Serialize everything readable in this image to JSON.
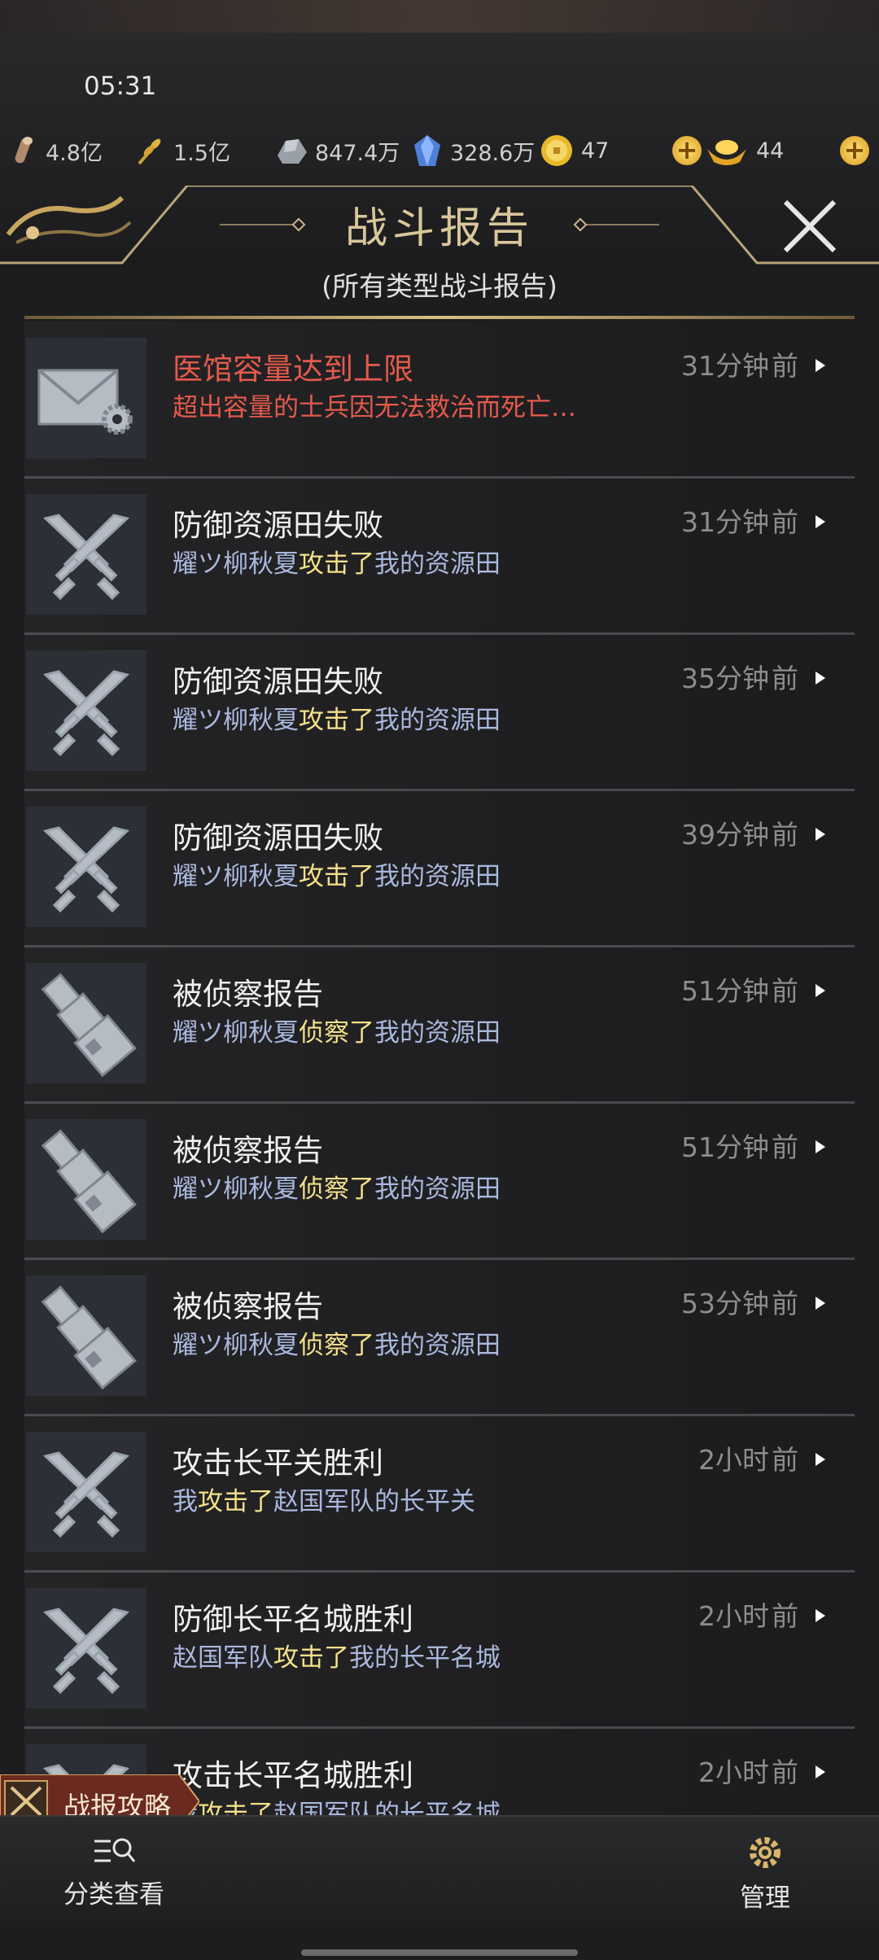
{
  "status_bar": {
    "time": "05:31"
  },
  "resources": [
    {
      "icon": "wood-log-icon",
      "value": "4.8亿"
    },
    {
      "icon": "wheat-icon",
      "value": "1.5亿"
    },
    {
      "icon": "stone-icon",
      "value": "847.4万"
    },
    {
      "icon": "crystal-icon",
      "value": "328.6万"
    },
    {
      "icon": "coin-icon",
      "value": "47"
    },
    {
      "icon": "gold-ingot-icon",
      "value": "44"
    }
  ],
  "header": {
    "title": "战斗报告",
    "subtitle": "(所有类型战斗报告)"
  },
  "reports": [
    {
      "icon": "mail-gear-icon",
      "title": "医馆容量达到上限",
      "title_color": "red",
      "desc_parts": [
        {
          "t": "超出容量的士兵因无法救治而死亡…",
          "c": "red"
        }
      ],
      "time": "31分钟",
      "ago": "前"
    },
    {
      "icon": "crossed-swords-icon",
      "title": "防御资源田失败",
      "desc_parts": [
        {
          "t": "耀ツ柳秋夏",
          "c": "n"
        },
        {
          "t": "攻击了",
          "c": "hl"
        },
        {
          "t": "我的资源田",
          "c": "n"
        }
      ],
      "time": "31分钟",
      "ago": "前"
    },
    {
      "icon": "crossed-swords-icon",
      "title": "防御资源田失败",
      "desc_parts": [
        {
          "t": "耀ツ柳秋夏",
          "c": "n"
        },
        {
          "t": "攻击了",
          "c": "hl"
        },
        {
          "t": "我的资源田",
          "c": "n"
        }
      ],
      "time": "35分钟",
      "ago": "前"
    },
    {
      "icon": "crossed-swords-icon",
      "title": "防御资源田失败",
      "desc_parts": [
        {
          "t": "耀ツ柳秋夏",
          "c": "n"
        },
        {
          "t": "攻击了",
          "c": "hl"
        },
        {
          "t": "我的资源田",
          "c": "n"
        }
      ],
      "time": "39分钟",
      "ago": "前"
    },
    {
      "icon": "spyglass-icon",
      "title": "被侦察报告",
      "desc_parts": [
        {
          "t": "耀ツ柳秋夏",
          "c": "n"
        },
        {
          "t": "侦察了",
          "c": "hl"
        },
        {
          "t": "我的资源田",
          "c": "n"
        }
      ],
      "time": "51分钟",
      "ago": "前"
    },
    {
      "icon": "spyglass-icon",
      "title": "被侦察报告",
      "desc_parts": [
        {
          "t": "耀ツ柳秋夏",
          "c": "n"
        },
        {
          "t": "侦察了",
          "c": "hl"
        },
        {
          "t": "我的资源田",
          "c": "n"
        }
      ],
      "time": "51分钟",
      "ago": "前"
    },
    {
      "icon": "spyglass-icon",
      "title": "被侦察报告",
      "desc_parts": [
        {
          "t": "耀ツ柳秋夏",
          "c": "n"
        },
        {
          "t": "侦察了",
          "c": "hl"
        },
        {
          "t": "我的资源田",
          "c": "n"
        }
      ],
      "time": "53分钟",
      "ago": "前"
    },
    {
      "icon": "crossed-swords-icon",
      "title": "攻击长平关胜利",
      "desc_parts": [
        {
          "t": "我",
          "c": "n"
        },
        {
          "t": "攻击了",
          "c": "hl"
        },
        {
          "t": "赵国军队的长平关",
          "c": "n"
        }
      ],
      "time": "2小时",
      "ago": "前"
    },
    {
      "icon": "crossed-swords-icon",
      "title": "防御长平名城胜利",
      "desc_parts": [
        {
          "t": "赵国军队",
          "c": "n"
        },
        {
          "t": "攻击了",
          "c": "hl"
        },
        {
          "t": "我的长平名城",
          "c": "n"
        }
      ],
      "time": "2小时",
      "ago": "前"
    },
    {
      "icon": "crossed-swords-icon",
      "title": "攻击长平名城胜利",
      "desc_parts": [
        {
          "t": "我",
          "c": "n"
        },
        {
          "t": "攻击了",
          "c": "hl"
        },
        {
          "t": "赵国军队的长平名城",
          "c": "n"
        }
      ],
      "time": "2小时",
      "ago": "前"
    }
  ],
  "guide_tab": {
    "label": "战报攻略"
  },
  "bottom_nav": {
    "filter_label": "分类查看",
    "manage_label": "管理"
  },
  "colors": {
    "accent_gold": "#d9c79a",
    "alert_red": "#e45a4c",
    "highlight_yellow": "#f4e08a",
    "name_blue": "#a9b8dd"
  }
}
